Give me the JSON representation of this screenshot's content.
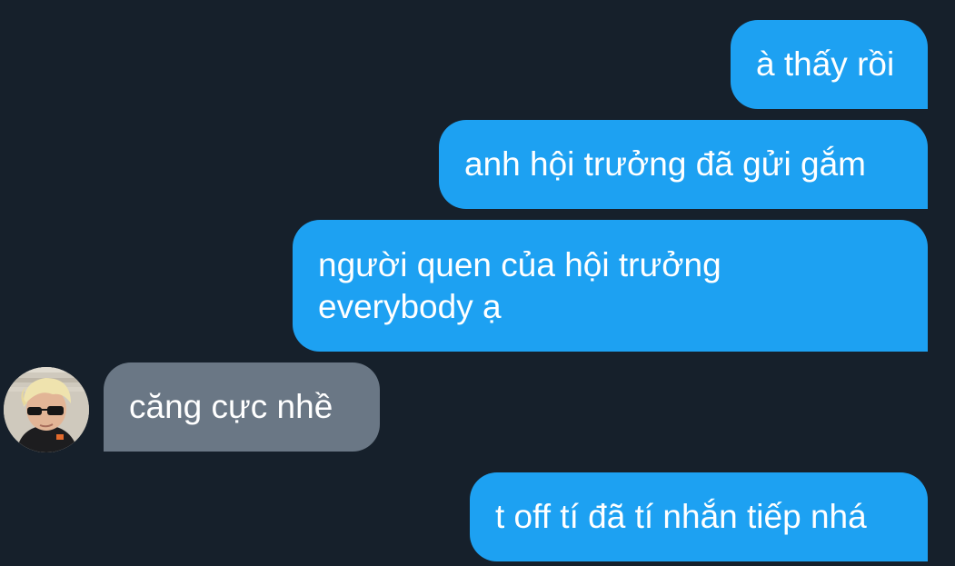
{
  "conversation": {
    "messages": [
      {
        "direction": "outgoing",
        "text": "à thấy rồi"
      },
      {
        "direction": "outgoing",
        "text": "anh hội trưởng đã gửi gắm"
      },
      {
        "direction": "outgoing",
        "text": "người quen của hội trưởng\neverybody ạ"
      },
      {
        "direction": "incoming",
        "text": "căng cực nhề",
        "avatar": "user-avatar"
      },
      {
        "direction": "outgoing",
        "text": "t off tí đã tí nhắn tiếp nhá"
      }
    ]
  },
  "colors": {
    "background": "#16202b",
    "outgoing_bubble": "#1da1f2",
    "incoming_bubble": "#6a7785",
    "text": "#ffffff"
  }
}
